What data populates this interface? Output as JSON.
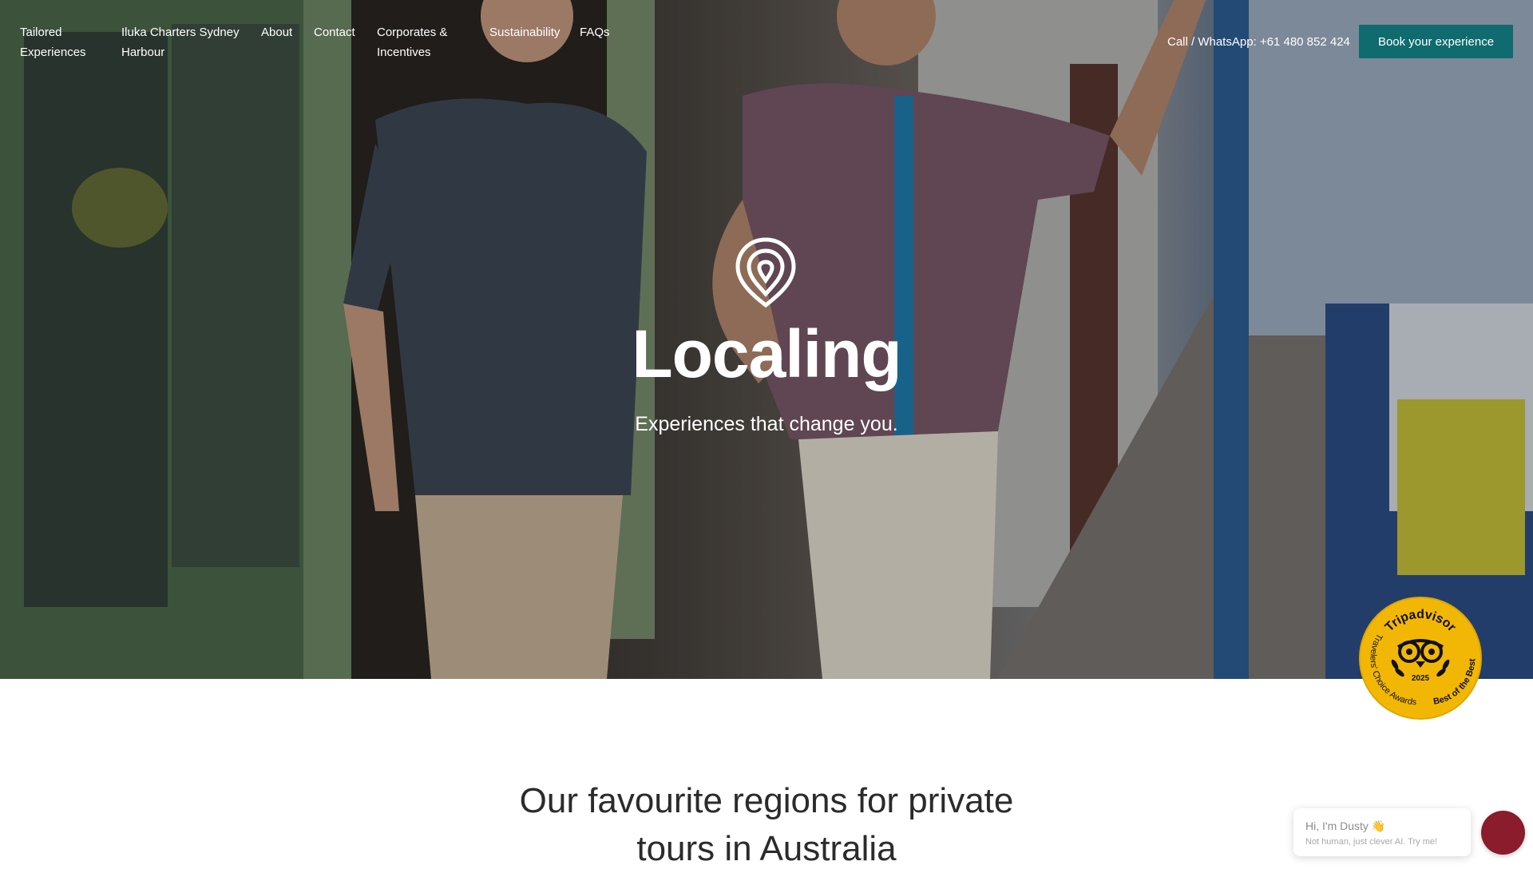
{
  "nav": {
    "items": [
      {
        "label_line1": "Tailored",
        "label_line2": "Experiences"
      },
      {
        "label_line1": "Iluka Charters Sydney",
        "label_line2": "Harbour"
      },
      {
        "label_line1": "About",
        "label_line2": ""
      },
      {
        "label_line1": "Contact",
        "label_line2": ""
      },
      {
        "label_line1": "Corporates &",
        "label_line2": "Incentives"
      },
      {
        "label_line1": "Sustainability",
        "label_line2": ""
      },
      {
        "label_line1": "FAQs",
        "label_line2": ""
      }
    ],
    "phone": "Call / WhatsApp: +61 480 852 424",
    "book_label": "Book your experience"
  },
  "hero": {
    "brand": "Localing",
    "tagline": "Experiences that change you."
  },
  "badge": {
    "top_text": "Tripadvisor",
    "left_text": "Travelers' Choice Awards",
    "right_text": "Best of the Best",
    "year": "2025"
  },
  "section": {
    "title_line1": "Our favourite regions for private",
    "title_line2": "tours in Australia"
  },
  "chat": {
    "title": "Hi, I'm Dusty 👋",
    "subtitle": "Not human, just clever AI. Try me!"
  },
  "colors": {
    "accent": "#0f6b6d",
    "badge": "#f2b705",
    "chat": "#8a1c2b"
  }
}
